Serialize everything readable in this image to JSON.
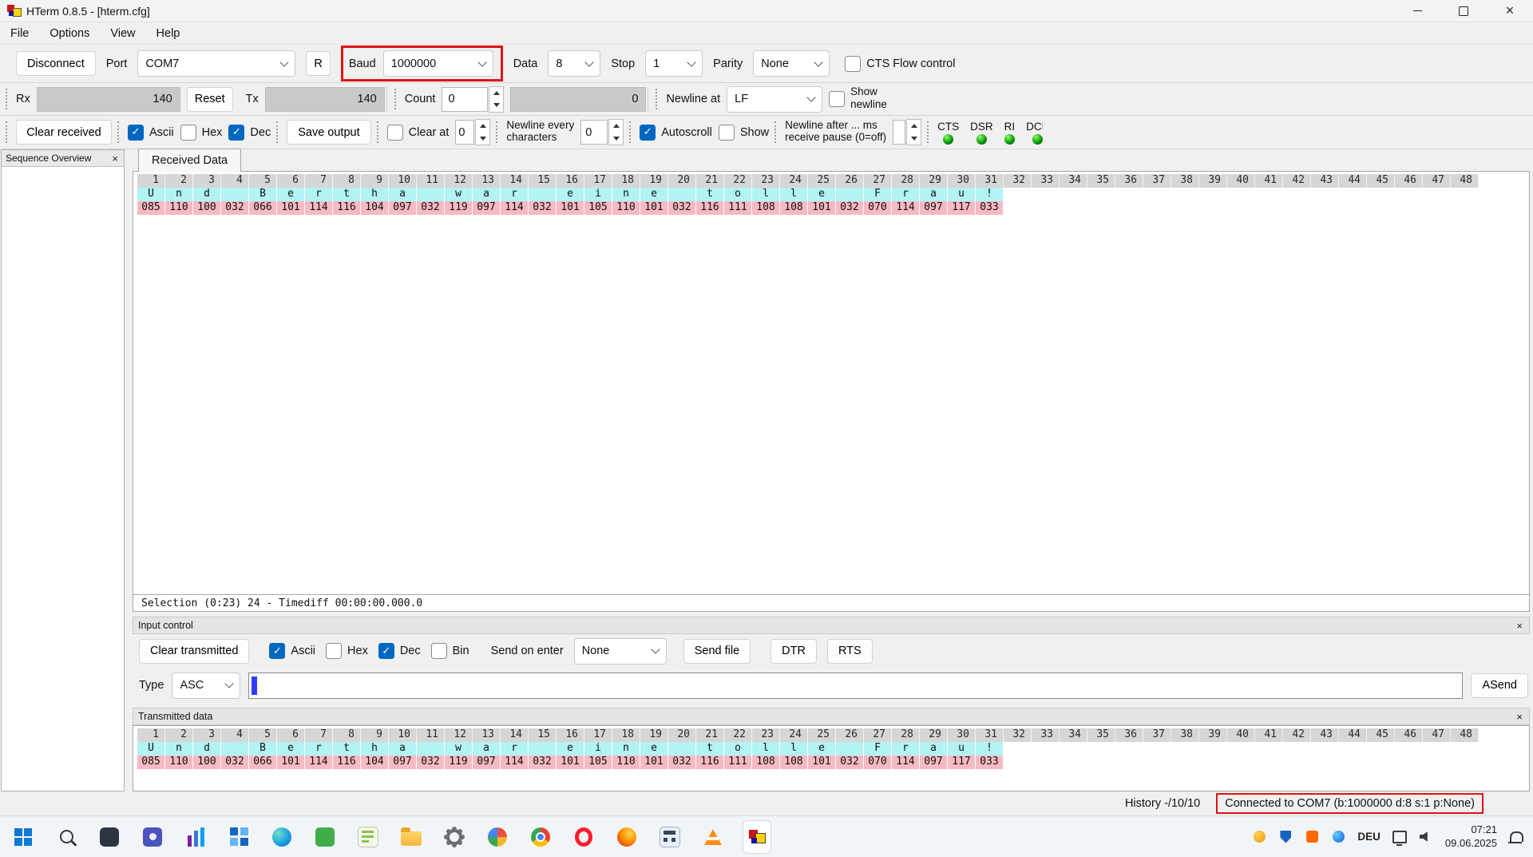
{
  "window": {
    "title": "HTerm 0.8.5 - [hterm.cfg]"
  },
  "icons": {
    "close": "×"
  },
  "menu": {
    "file": "File",
    "options": "Options",
    "view": "View",
    "help": "Help"
  },
  "connection": {
    "disconnect": "Disconnect",
    "port_label": "Port",
    "port_value": "COM7",
    "refresh": "R",
    "baud_label": "Baud",
    "baud_value": "1000000",
    "data_label": "Data",
    "data_value": "8",
    "stop_label": "Stop",
    "stop_value": "1",
    "parity_label": "Parity",
    "parity_value": "None",
    "cts_flow_label": "CTS Flow control"
  },
  "counters": {
    "rx_label": "Rx",
    "rx_value": "140",
    "reset": "Reset",
    "tx_label": "Tx",
    "tx_value": "140",
    "count_label": "Count",
    "count_value": "0",
    "count_total": "0",
    "newline_at_label": "Newline at",
    "newline_at_value": "LF",
    "show_newline_line1": "Show",
    "show_newline_line2": "newline"
  },
  "display": {
    "clear_received": "Clear received",
    "ascii_label": "Ascii",
    "hex_label": "Hex",
    "dec_label": "Dec",
    "save_output": "Save output",
    "clear_at_label": "Clear at",
    "clear_at_value": "0",
    "newline_every_label": "Newline every",
    "newline_every_value": "0",
    "characters_label": "characters",
    "autoscroll_label": "Autoscroll",
    "show_label": "Show",
    "newline_after_label": "Newline after ... ms",
    "receive_pause_label": "receive pause (0=off)",
    "led_cts": "CTS",
    "led_dsr": "DSR",
    "led_ri": "RI",
    "led_dcd": "DCD"
  },
  "sidebar": {
    "title": "Sequence Overview"
  },
  "received": {
    "tab_label": "Received Data",
    "selection_status": "Selection (0:23) 24  -  Timediff 00:00:00.000.0"
  },
  "grid": {
    "columns": 48,
    "chars": [
      "U",
      "n",
      "d",
      "",
      "B",
      "e",
      "r",
      "t",
      "h",
      "a",
      "",
      "w",
      "a",
      "r",
      "",
      "e",
      "i",
      "n",
      "e",
      "",
      "t",
      "o",
      "l",
      "l",
      "e",
      "",
      "F",
      "r",
      "a",
      "u",
      "!"
    ],
    "decs": [
      "085",
      "110",
      "100",
      "032",
      "066",
      "101",
      "114",
      "116",
      "104",
      "097",
      "032",
      "119",
      "097",
      "114",
      "032",
      "101",
      "105",
      "110",
      "101",
      "032",
      "116",
      "111",
      "108",
      "108",
      "101",
      "032",
      "070",
      "114",
      "097",
      "117",
      "033"
    ]
  },
  "input_control": {
    "header": "Input control",
    "clear_transmitted": "Clear transmitted",
    "ascii_label": "Ascii",
    "hex_label": "Hex",
    "dec_label": "Dec",
    "bin_label": "Bin",
    "send_on_enter_label": "Send on enter",
    "send_on_enter_value": "None",
    "send_file": "Send file",
    "dtr": "DTR",
    "rts": "RTS",
    "type_label": "Type",
    "type_value": "ASC",
    "input_value": "",
    "asend": "ASend"
  },
  "transmitted": {
    "header": "Transmitted data"
  },
  "status": {
    "history": "History -/10/10",
    "connection": "Connected to COM7 (b:1000000 d:8 s:1 p:None)"
  },
  "taskbar": {
    "language": "DEU",
    "time": "07:21",
    "date": "09.06.2025"
  }
}
